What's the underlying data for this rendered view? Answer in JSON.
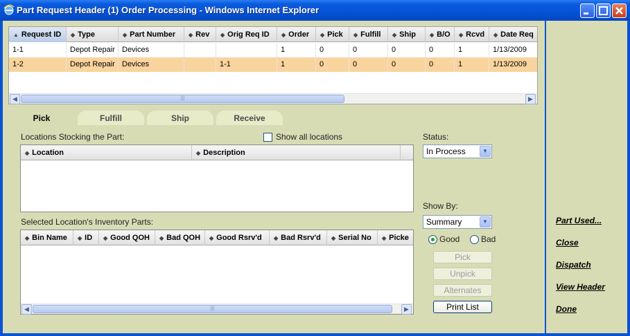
{
  "window": {
    "title": "Part Request Header (1) Order Processing - Windows Internet Explorer",
    "icon": "ie-icon",
    "controls": [
      "minimize-icon",
      "maximize-icon",
      "close-icon"
    ]
  },
  "request_grid": {
    "columns": [
      "Request ID",
      "Type",
      "Part Number",
      "Rev",
      "Orig Req ID",
      "Order",
      "Pick",
      "Fulfill",
      "Ship",
      "B/O",
      "Rcvd",
      "Date Req"
    ],
    "sorted_column": "Request ID",
    "rows": [
      [
        "1-1",
        "Depot Repair",
        "Devices",
        "",
        "",
        "1",
        "0",
        "0",
        "0",
        "0",
        "1",
        "1/13/2009"
      ],
      [
        "1-2",
        "Depot Repair",
        "Devices",
        "",
        "1-1",
        "1",
        "0",
        "0",
        "0",
        "0",
        "1",
        "1/13/2009"
      ]
    ],
    "selected_row": 1
  },
  "tabs": [
    {
      "label": "Pick",
      "active": true
    },
    {
      "label": "Fulfill",
      "active": false
    },
    {
      "label": "Ship",
      "active": false
    },
    {
      "label": "Receive",
      "active": false
    }
  ],
  "pick": {
    "locations_label": "Locations Stocking the Part:",
    "show_all_label": "Show all locations",
    "show_all_checked": false,
    "location_columns": [
      "Location",
      "Description"
    ],
    "inventory_label": "Selected Location's Inventory Parts:",
    "inventory_columns": [
      "Bin Name",
      "ID",
      "Good QOH",
      "Bad QOH",
      "Good Rsrv'd",
      "Bad Rsrv'd",
      "Serial No",
      "Picke"
    ],
    "status_label": "Status:",
    "status_value": "In Process",
    "show_by_label": "Show By:",
    "show_by_value": "Summary",
    "radio_good": "Good",
    "radio_bad": "Bad",
    "radio_selected": "Good",
    "buttons": {
      "pick": "Pick",
      "unpick": "Unpick",
      "alternates": "Alternates",
      "print_list": "Print List"
    }
  },
  "side_links": [
    "Part Used...",
    "Close",
    "Dispatch",
    "View Header",
    "Done"
  ],
  "colors": {
    "panel_bg": "#d8dcb4",
    "selected_row": "#f9d49e",
    "titlebar": "#0553d6"
  }
}
